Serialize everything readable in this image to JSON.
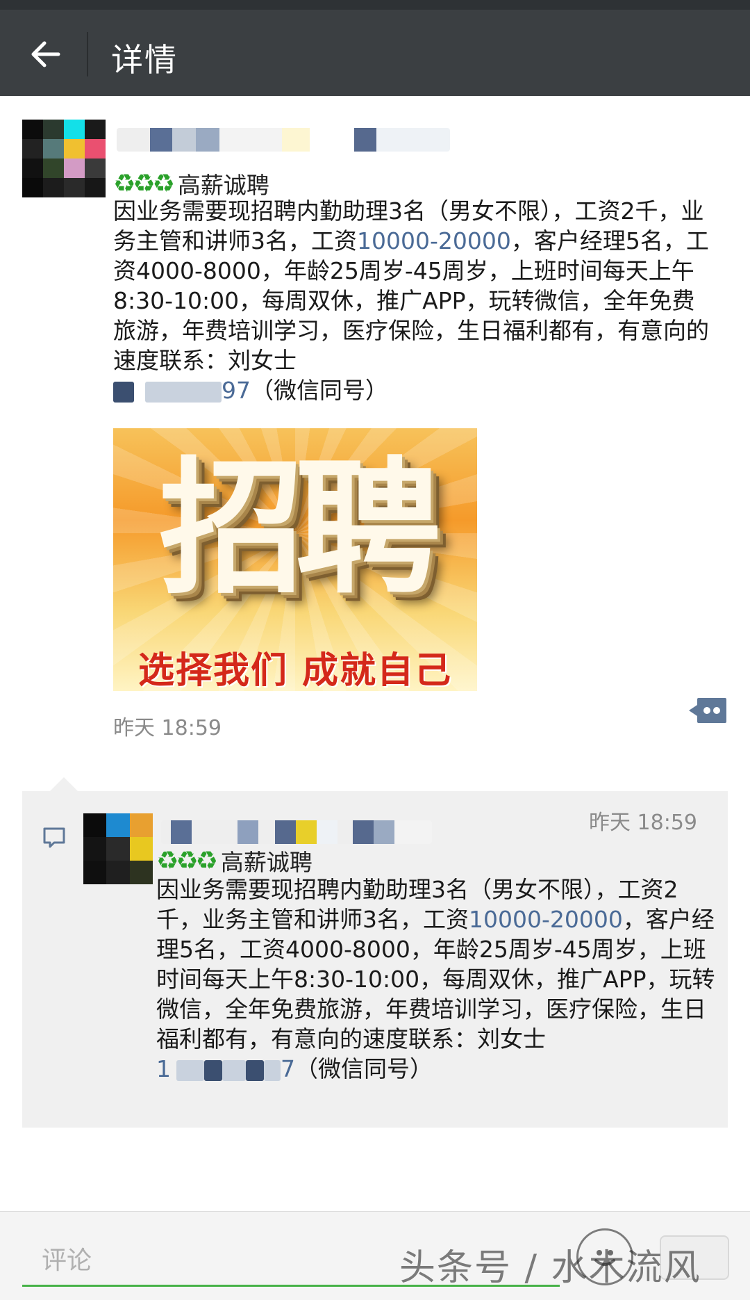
{
  "header": {
    "back_icon": "arrow-left-icon",
    "title": "详情"
  },
  "post": {
    "label_emoji": "♻♻♻",
    "label": "高薪诚聘",
    "text_1": "因业务需要现招聘内勤助理3名（男女不限），工资2千，业务主管和讲师3名，工资",
    "link_1": "10000-20000",
    "text_2": "，客户经理5名，工资4000-8000，年龄25周岁-45周岁，上班时间每天上午8:30-10:00，每周双休，推广APP，玩转微信，全年免费旅游，年费培训学习，医疗保险，生日福利都有，有意向的速度联系：刘女士",
    "phone_tail": "97",
    "text_3": "（微信同号）",
    "image": {
      "big_text": "招聘",
      "slogan": "选择我们 成就自己"
    },
    "time": "昨天 18:59",
    "comment_toggle_icon": "more-dots-icon"
  },
  "comment": {
    "icon": "comment-bubble-icon",
    "time": "昨天 18:59",
    "label_emoji": "♻♻♻",
    "label": "高薪诚聘",
    "text_1": "因业务需要现招聘内勤助理3名（男女不限），工资2千，业务主管和讲师3名，工资",
    "link_1": "10000-20000",
    "text_2": "，客户经理5名，工资4000-8000，年龄25周岁-45周岁，上班时间每天上午8:30-10:00，每周双休，推广APP，玩转微信，全年免费旅游，年费培训学习，医疗保险，生日福利都有，有意向的速度联系：刘女士",
    "phone_head": "1",
    "phone_tail": "7",
    "text_3": "（微信同号）"
  },
  "footer": {
    "comment_placeholder": "评论",
    "emoji_icon": "smiley-icon",
    "watermark": "头条号 / 水木流风"
  },
  "colors": {
    "header_bg": "#3b3f42",
    "link": "#4a6a96",
    "input_underline": "#46b247",
    "recycle_green": "#2aa12a"
  }
}
